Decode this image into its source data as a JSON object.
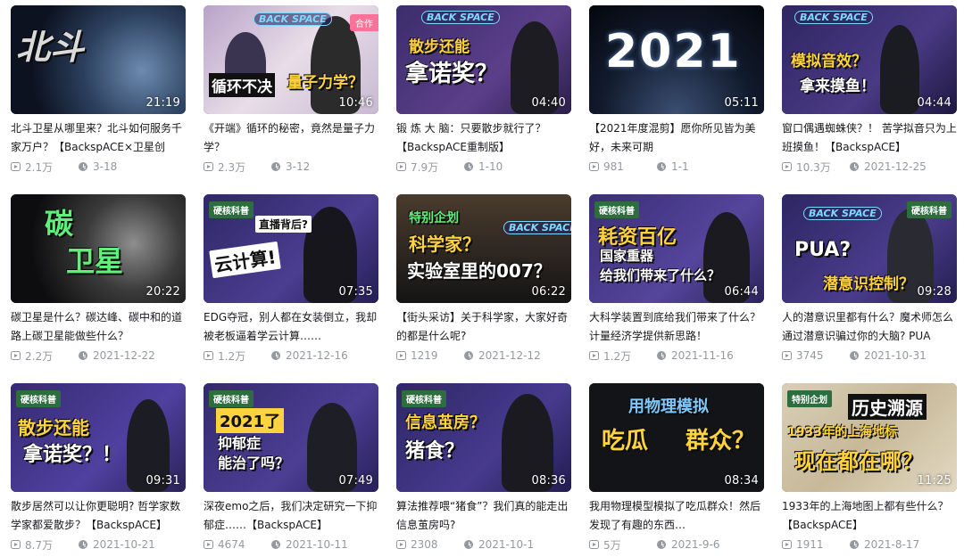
{
  "videos": [
    {
      "duration": "21:19",
      "title": "北斗卫星从哪里来？北斗如何服务千家万户？【BackspACE×卫星创",
      "views": "2.1万",
      "date": "3-18",
      "overlay": [
        "北斗"
      ]
    },
    {
      "duration": "10:46",
      "title": "《开端》循环的秘密，竟然是量子力学？",
      "views": "2.3万",
      "date": "3-12",
      "badge": "合作",
      "overlay": [
        "循环不决",
        "量子力学？"
      ],
      "logo": "BACK SPACE"
    },
    {
      "duration": "04:40",
      "title": "锻 炼 大 脑：只要散步就行了？【BackspACE重制版】",
      "views": "7.9万",
      "date": "1-10",
      "overlay": [
        "散步还能",
        "拿诺奖？"
      ],
      "logo": "BACK SPACE"
    },
    {
      "duration": "05:11",
      "title": "【2021年度混剪】愿你所见皆为美好，未来可期",
      "views": "981",
      "date": "1-1",
      "overlay": [
        "2021"
      ]
    },
    {
      "duration": "04:44",
      "title": "窗口偶遇蜘蛛侠？！ 苦学拟音只为上班摸鱼！【BackspACE】",
      "views": "10.3万",
      "date": "2021-12-25",
      "overlay": [
        "模拟音效？",
        "拿来摸鱼！"
      ],
      "logo": "BACK SPACE"
    },
    {
      "duration": "20:22",
      "title": "碳卫星是什么？碳达峰、碳中和的道路上碳卫星能做些什么？",
      "views": "2.2万",
      "date": "2021-12-22",
      "overlay": [
        "碳",
        "卫星"
      ]
    },
    {
      "duration": "07:35",
      "title": "EDG夺冠，别人都在女装倒立，我却被老板逼着学云计算……",
      "views": "1.2万",
      "date": "2021-12-16",
      "tag": "硬核科普",
      "overlay": [
        "直播背后?",
        "云计算!"
      ]
    },
    {
      "duration": "06:22",
      "title": "【街头采访】关于科学家，大家好奇的都是什么呢?",
      "views": "1219",
      "date": "2021-12-12",
      "overlay": [
        "特别企划",
        "科学家？",
        "实验室里的007？"
      ],
      "logo": "BACK SPACE"
    },
    {
      "duration": "06:44",
      "title": "大科学装置到底给我们带来了什么？计量经济学提供新思路！",
      "views": "1.2万",
      "date": "2021-11-16",
      "tag": "硬核科普",
      "overlay": [
        "耗资百亿",
        "国家重器",
        "给我们带来了什么？"
      ]
    },
    {
      "duration": "09:28",
      "title": "人的潜意识里都有什么？魔术师怎么通过潜意识骗过你的大脑? PUA",
      "views": "3745",
      "date": "2021-10-31",
      "tag": "硬核科普",
      "overlay": [
        "PUA?",
        "潜意识控制？"
      ],
      "logo": "BACK SPACE"
    },
    {
      "duration": "09:31",
      "title": "散步居然可以让你更聪明? 哲学家数学家都爱散步？【BackspACE】",
      "views": "8.7万",
      "date": "2021-10-21",
      "tag": "硬核科普",
      "overlay": [
        "散步还能",
        "拿诺奖？！"
      ]
    },
    {
      "duration": "07:49",
      "title": "深夜emo之后，我们决定研究一下抑郁症……【BackspACE】",
      "views": "4674",
      "date": "2021-10-11",
      "tag": "硬核科普",
      "overlay": [
        "2021了",
        "抑郁症",
        "能治了吗？"
      ]
    },
    {
      "duration": "08:36",
      "title": "算法推荐喂“猪食”？我们真的能走出信息茧房吗?",
      "views": "2308",
      "date": "2021-10-1",
      "tag": "硬核科普",
      "overlay": [
        "信息茧房？",
        "猪食？"
      ]
    },
    {
      "duration": "08:34",
      "title": "我用物理模型模拟了吃瓜群众！然后发现了有趣的东西…",
      "views": "5万",
      "date": "2021-9-6",
      "overlay": [
        "用物理模拟",
        "吃瓜",
        "群众？"
      ]
    },
    {
      "duration": "11:25",
      "title": "1933年的上海地图上都有些什么？【BackspACE】",
      "views": "1911",
      "date": "2021-8-17",
      "tag": "特别企划",
      "overlay": [
        "历史溯源",
        "1933年的上海地标",
        "现在都在哪？"
      ]
    }
  ]
}
